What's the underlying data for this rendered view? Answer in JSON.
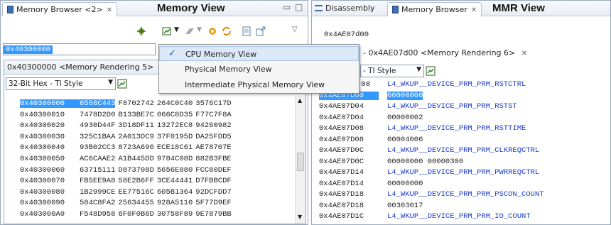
{
  "left": {
    "tab_title": "Memory Browser <2>",
    "annotation": "Memory View",
    "address": "0x40300000",
    "render_tab": "0x40300000 <Memory Rendering 5>",
    "format": "32-Bit Hex - TI Style",
    "rows": [
      {
        "addr": "0x40300000",
        "v": [
          "6568C443",
          "F8702742",
          "264C0C40",
          "3576C17D"
        ]
      },
      {
        "addr": "0x40300010",
        "v": [
          "7478D2D0",
          "B133BE7C",
          "066C8D35",
          "F77C7F8A"
        ]
      },
      {
        "addr": "0x40300020",
        "v": [
          "4930D44F",
          "3D18DF11",
          "13272EC8",
          "94260982"
        ]
      },
      {
        "addr": "0x40300030",
        "v": [
          "325C1BAA",
          "2A013DC9",
          "37F0195D",
          "DA25FDD5"
        ]
      },
      {
        "addr": "0x40300040",
        "v": [
          "93B02CC3",
          "8723A696",
          "ECE18C61",
          "AE78707E"
        ]
      },
      {
        "addr": "0x40300050",
        "v": [
          "AC6CAAE2",
          "A1B445DD",
          "9784C08D",
          "882B3FBE"
        ]
      },
      {
        "addr": "0x40300060",
        "v": [
          "63715111",
          "D873708D",
          "5656E880",
          "FCC80DEF"
        ]
      },
      {
        "addr": "0x40300070",
        "v": [
          "FB5EE9A8",
          "58E2B6FF",
          "3CE44441",
          "D7FBBCDF"
        ]
      },
      {
        "addr": "0x40300080",
        "v": [
          "1B2999CE",
          "EE77516C",
          "605B1364",
          "92DCFDD7"
        ]
      },
      {
        "addr": "0x40300090",
        "v": [
          "584C8FA2",
          "25634455",
          "928A5110",
          "5F77D9EF"
        ]
      },
      {
        "addr": "0x403000A0",
        "v": [
          "F548D958",
          "6F0F0B6D",
          "30758F89",
          "9E7879BB"
        ]
      }
    ]
  },
  "menu": {
    "items": [
      "CPU Memory View",
      "Physical Memory View",
      "Intermediate Physical Memory View"
    ],
    "checked_mark": "✓"
  },
  "right": {
    "tab_disassembly": "Disassembly",
    "tab_browser": "Memory Browser",
    "annotation": "MMR View",
    "address": "0x4AE07d00",
    "render_tab": "- 0x4AE07d00 <Memory Rendering 6>",
    "format": "- TI Style",
    "rows": [
      {
        "addr": "00",
        "val": "L4_WKUP__DEVICE_PRM_PRM_RSTCTRL",
        "reg": true,
        "addr_partial": true
      },
      {
        "addr": "0x4AE07D00",
        "val": "00000000",
        "reg": false,
        "hl": true
      },
      {
        "addr": "0x4AE07D04",
        "val": "L4_WKUP__DEVICE_PRM_PRM_RSTST",
        "reg": true
      },
      {
        "addr": "0x4AE07D04",
        "val": "00000002",
        "reg": false
      },
      {
        "addr": "0x4AE07D08",
        "val": "L4_WKUP__DEVICE_PRM_PRM_RSTTIME",
        "reg": true
      },
      {
        "addr": "0x4AE07D08",
        "val": "00004006",
        "reg": false
      },
      {
        "addr": "0x4AE07D0C",
        "val": "L4_WKUP__DEVICE_PRM_PRM_CLKREQCTRL",
        "reg": true
      },
      {
        "addr": "0x4AE07D0C",
        "val": "00000000 00000300",
        "reg": false
      },
      {
        "addr": "0x4AE07D14",
        "val": "L4_WKUP__DEVICE_PRM_PRM_PWRREQCTRL",
        "reg": true
      },
      {
        "addr": "0x4AE07D14",
        "val": "00000000",
        "reg": false
      },
      {
        "addr": "0x4AE07D18",
        "val": "L4_WKUP__DEVICE_PRM_PRM_PSCON_COUNT",
        "reg": true
      },
      {
        "addr": "0x4AE07D18",
        "val": "00303017",
        "reg": false
      },
      {
        "addr": "0x4AE07D1C",
        "val": "L4_WKUP__DEVICE_PRM_PRM_IO_COUNT",
        "reg": true
      }
    ]
  },
  "colors": {
    "accent": "#3399ff",
    "register": "#1b3bd1"
  }
}
